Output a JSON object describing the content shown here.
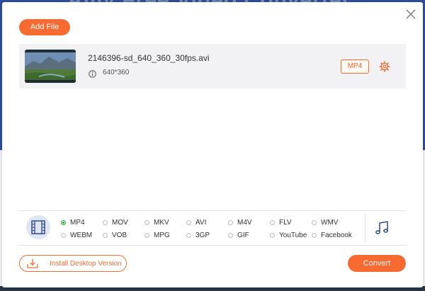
{
  "background_title": "Amy Free Video Converter",
  "dialog": {
    "add_file_label": "Add File",
    "close_icon": "close-icon"
  },
  "file": {
    "name": "2146396-sd_640_360_30fps.avi",
    "resolution": "640*360",
    "output_format": "MP4",
    "thumbnail_icon": "video-thumbnail",
    "info_icon": "info-icon",
    "settings_icon": "gear-icon"
  },
  "formats": {
    "video_icon": "film-icon",
    "audio_icon": "music-note-icon",
    "selected": "MP4",
    "row1": [
      "MP4",
      "MOV",
      "MKV",
      "AVI",
      "M4V",
      "FLV",
      "WMV"
    ],
    "row2": [
      "WEBM",
      "VOB",
      "MPG",
      "3GP",
      "GIF",
      "YouTube",
      "Facebook"
    ]
  },
  "footer": {
    "install_label": "Install Desktop Version",
    "install_icon": "download-icon",
    "convert_label": "Convert"
  },
  "colors": {
    "accent": "#f76b33",
    "radio_selected": "#2eaa45",
    "video_icon_bg": "#dfe5f2",
    "icon_blue": "#2d4b8a"
  }
}
